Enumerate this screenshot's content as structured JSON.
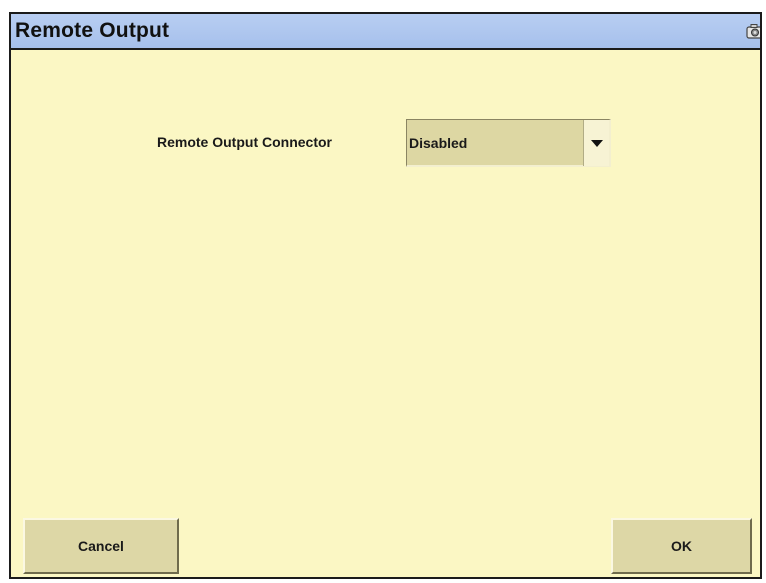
{
  "window": {
    "title": "Remote Output",
    "title_icon": "camera-icon"
  },
  "form": {
    "connector_label": "Remote Output Connector",
    "connector_value": "Disabled"
  },
  "buttons": {
    "cancel_label": "Cancel",
    "ok_label": "OK"
  },
  "colors": {
    "background": "#fbf7c4",
    "titlebar": "#b3caf0",
    "button": "#ddd7a6"
  }
}
